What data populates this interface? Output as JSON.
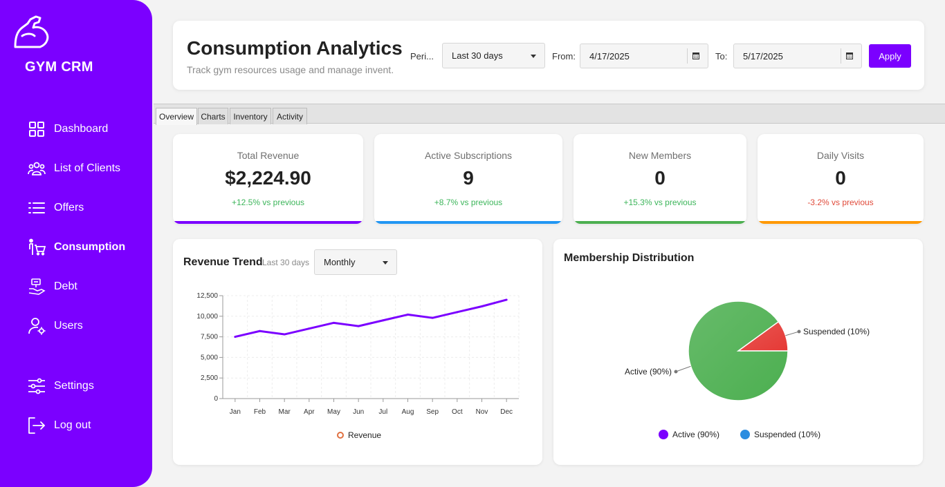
{
  "sidebar": {
    "brand": "GYM CRM",
    "items": [
      {
        "label": "Dashboard",
        "icon": "dashboard-icon"
      },
      {
        "label": "List of Clients",
        "icon": "clients-icon"
      },
      {
        "label": "Offers",
        "icon": "list-icon"
      },
      {
        "label": "Consumption",
        "icon": "cart-person-icon",
        "active": true
      },
      {
        "label": "Debt",
        "icon": "debt-icon"
      },
      {
        "label": "Users",
        "icon": "user-gear-icon"
      },
      {
        "label": "Settings",
        "icon": "sliders-icon"
      },
      {
        "label": "Log out",
        "icon": "logout-icon"
      }
    ]
  },
  "header": {
    "title": "Consumption Analytics",
    "subtitle": "Track gym resources usage and manage invent...",
    "period_label": "Peri...",
    "period_value": "Last 30 days",
    "from_label": "From:",
    "from_value": "4/17/2025",
    "to_label": "To:",
    "to_value": "5/17/2025",
    "apply_label": "Apply"
  },
  "tabs": [
    "Overview",
    "Charts",
    "Inventory",
    "Activity"
  ],
  "active_tab": "Overview",
  "stats": [
    {
      "label": "Total Revenue",
      "value": "$2,224.90",
      "change": "+12.5% vs previous",
      "change_color": "#3cb55a",
      "bar_color": "#7b00ff"
    },
    {
      "label": "Active Subscriptions",
      "value": "9",
      "change": "+8.7% vs previous",
      "change_color": "#3cb55a",
      "bar_color": "#2196f3"
    },
    {
      "label": "New Members",
      "value": "0",
      "change": "+15.3% vs previous",
      "change_color": "#3cb55a",
      "bar_color": "#4caf50"
    },
    {
      "label": "Daily Visits",
      "value": "0",
      "change": "-3.2% vs previous",
      "change_color": "#e04a3a",
      "bar_color": "#ff9800"
    }
  ],
  "revenue_trend": {
    "title": "Revenue Trend",
    "range_label": "Last 30 days",
    "granularity": "Monthly",
    "legend": "Revenue"
  },
  "membership": {
    "title": "Membership Distribution",
    "legend": [
      {
        "label": "Active (90%)",
        "color": "#7b00ff"
      },
      {
        "label": "Suspended (10%)",
        "color": "#2b8de0"
      }
    ]
  },
  "chart_data": [
    {
      "type": "line",
      "title": "Revenue Trend",
      "categories": [
        "Jan",
        "Feb",
        "Mar",
        "Apr",
        "May",
        "Jun",
        "Jul",
        "Aug",
        "Sep",
        "Oct",
        "Nov",
        "Dec"
      ],
      "series": [
        {
          "name": "Revenue",
          "color": "#7b00ff",
          "values": [
            7500,
            8200,
            7800,
            8500,
            9200,
            8800,
            9500,
            10200,
            9800,
            10500,
            11200,
            12000
          ]
        }
      ],
      "yticks": [
        "0",
        "2,500",
        "5,000",
        "7,500",
        "10,000",
        "12,500"
      ],
      "ylim": [
        0,
        12500
      ],
      "grid": true,
      "legend": "bottom"
    },
    {
      "type": "pie",
      "title": "Membership Distribution",
      "slices": [
        {
          "label": "Active (90%)",
          "value": 90,
          "color": "#4caf50"
        },
        {
          "label": "Suspended (10%)",
          "value": 10,
          "color": "#e53935"
        }
      ],
      "legend": "bottom"
    }
  ]
}
